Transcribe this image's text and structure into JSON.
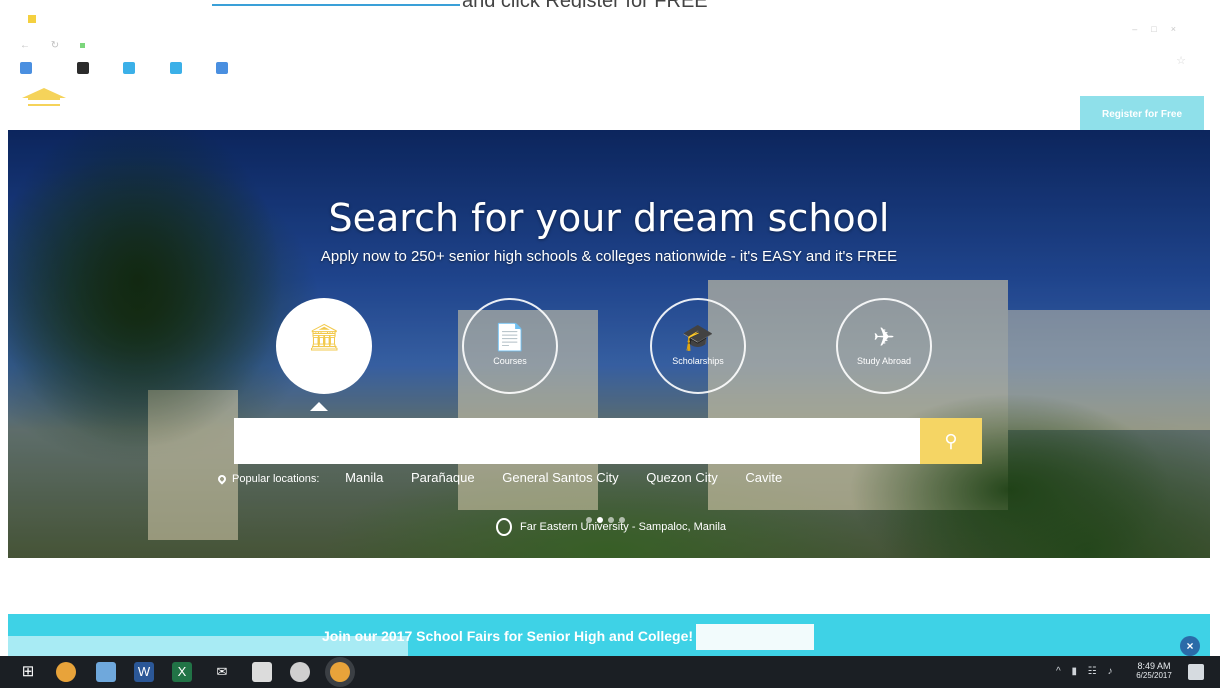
{
  "instruction": {
    "link_text": "",
    "after_link": "and click Register for FREE"
  },
  "browser": {
    "tab_title": "",
    "url": "",
    "bookmarks": [
      {
        "label": "",
        "color": "#4a8fe0"
      },
      {
        "label": "",
        "color": "#2b2b2b"
      },
      {
        "label": "",
        "color": "#3bb0e8"
      },
      {
        "label": "",
        "color": "#3bb0e8"
      },
      {
        "label": "",
        "color": "#4a8fe0"
      }
    ]
  },
  "header": {
    "register_label": "Register for Free"
  },
  "hero": {
    "title": "Search for your dream school",
    "subtitle": "Apply now to 250+ senior high schools & colleges nationwide - it's EASY and it's FREE",
    "categories": [
      {
        "label": "",
        "icon": "institution-icon",
        "active": true
      },
      {
        "label": "Courses",
        "icon": "document-icon",
        "active": false
      },
      {
        "label": "Scholarships",
        "icon": "graduation-cap-icon",
        "active": false
      },
      {
        "label": "Study Abroad",
        "icon": "airplane-icon",
        "active": false
      }
    ],
    "search_placeholder": "",
    "popular_label": "Popular locations:",
    "locations": [
      "Manila",
      "Parañaque",
      "General Santos City",
      "Quezon City",
      "Cavite"
    ],
    "caption": "Far Eastern University - Sampaloc, Manila"
  },
  "promo": {
    "text": "Join our 2017 School Fairs for Senior High and College!",
    "button_label": ""
  },
  "taskbar": {
    "time": "8:49 AM",
    "date": "6/25/2017"
  },
  "colors": {
    "accent_yellow": "#f5d564",
    "promo_cyan": "#3ed2e6",
    "register_cyan": "#8fe0ea"
  }
}
